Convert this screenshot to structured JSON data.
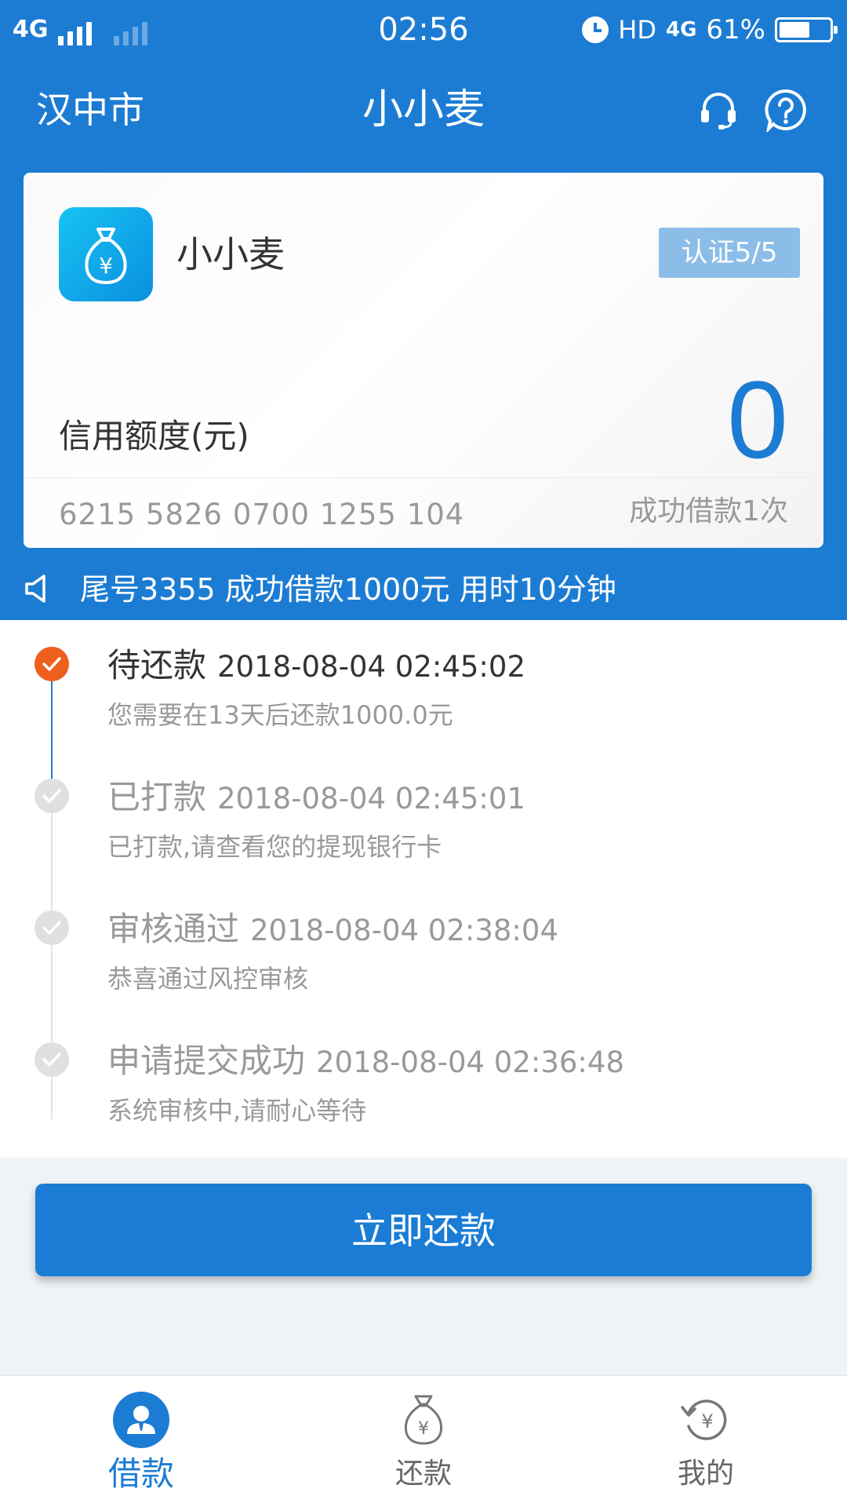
{
  "status_bar": {
    "network": "4G",
    "time": "02:56",
    "hd": "HD",
    "network2": "4G",
    "battery": "61%",
    "battery_level": 0.61
  },
  "nav": {
    "city": "汉中市",
    "title": "小小麦"
  },
  "card": {
    "app_name": "小小麦",
    "cert": "认证5/5",
    "credit_label": "信用额度(元)",
    "credit_value": "0",
    "card_number": "6215 5826 0700 1255 104",
    "success_count": "成功借款1次"
  },
  "notice": {
    "text": "尾号3355 成功借款1000元 用时10分钟"
  },
  "timeline": [
    {
      "title": "待还款",
      "time": "2018-08-04 02:45:02",
      "desc": "您需要在13天后还款1000.0元"
    },
    {
      "title": "已打款",
      "time": "2018-08-04 02:45:01",
      "desc": "已打款,请查看您的提现银行卡"
    },
    {
      "title": "审核通过",
      "time": "2018-08-04 02:38:04",
      "desc": "恭喜通过风控审核"
    },
    {
      "title": "申请提交成功",
      "time": "2018-08-04 02:36:48",
      "desc": "系统审核中,请耐心等待"
    }
  ],
  "repay_button": "立即还款",
  "bottom_nav": [
    {
      "label": "借款",
      "icon": "user-badge-icon"
    },
    {
      "label": "还款",
      "icon": "money-bag-icon"
    },
    {
      "label": "我的",
      "icon": "refresh-yen-icon"
    }
  ],
  "colors": {
    "primary": "#1c7cd3",
    "accent": "#ec5f1c",
    "badge": "#8cbde8"
  }
}
